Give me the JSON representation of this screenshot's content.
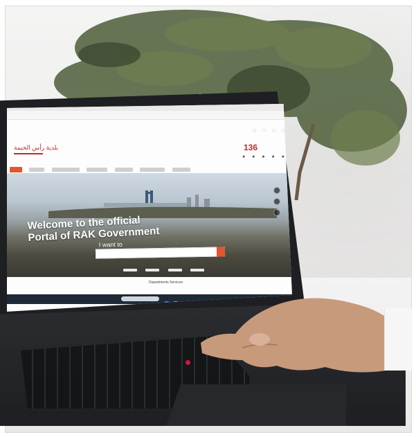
{
  "scene": "laptop-on-desk",
  "colors": {
    "brand_red": "#c62828",
    "accent_orange": "#e2562e",
    "laptop_body": "#1d1f22",
    "wall": "#f1f1f0"
  },
  "screen": {
    "site_logo_text": "بلدية رأس الخيمة",
    "hotline": "136",
    "hero_title_line1": "Welcome to the official",
    "hero_title_line2": "Portal of RAK Government",
    "search_prompt": "I want to",
    "section_label": "Departments Services"
  }
}
